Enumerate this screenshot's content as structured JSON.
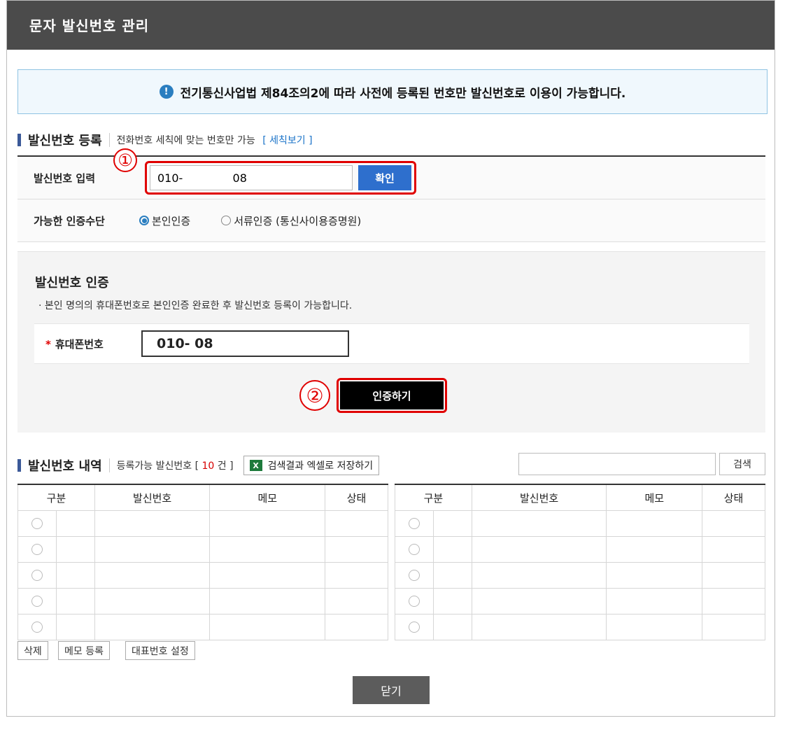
{
  "window": {
    "title": "문자 발신번호 관리"
  },
  "notice": {
    "icon": "info-icon",
    "text": "전기통신사업법 제84조의2에 따라 사전에 등록된 번호만 발신번호로 이용이 가능합니다."
  },
  "register": {
    "title": "발신번호 등록",
    "subtitle": "전화번호 세칙에 맞는 번호만 가능",
    "rules_link": "[ 세칙보기 ]",
    "input_label": "발신번호 입력",
    "input_value": "010-              08",
    "confirm_label": "확인",
    "method_label": "가능한 인증수단",
    "methods": [
      {
        "label": "본인인증",
        "selected": true
      },
      {
        "label": "서류인증 (통신사이용증명원)",
        "selected": false
      }
    ]
  },
  "markers": {
    "one": "①",
    "two": "②"
  },
  "auth": {
    "title": "발신번호 인증",
    "desc": "· 본인 명의의 휴대폰번호로 본인인증 완료한 후 발신번호 등록이 가능합니다.",
    "required_mark": "*",
    "phone_label": "휴대폰번호",
    "phone_value": "010-              08",
    "button_label": "인증하기"
  },
  "history": {
    "title": "발신번호 내역",
    "sub_prefix": "등록가능 발신번호 [",
    "count": "10",
    "sub_suffix": "건 ]",
    "excel_icon": "X",
    "excel_label": "검색결과 엑셀로 저장하기",
    "search_label": "검색",
    "columns": [
      "구분",
      "발신번호",
      "메모",
      "상태"
    ]
  },
  "actions": {
    "delete": "삭제",
    "memo": "메모 등록",
    "main_number": "대표번호 설정",
    "close": "닫기"
  },
  "colors": {
    "header_bg": "#4b4b4b",
    "confirm_blue": "#2e6fcd",
    "highlight_red": "#e00000",
    "count_red": "#d60000"
  }
}
